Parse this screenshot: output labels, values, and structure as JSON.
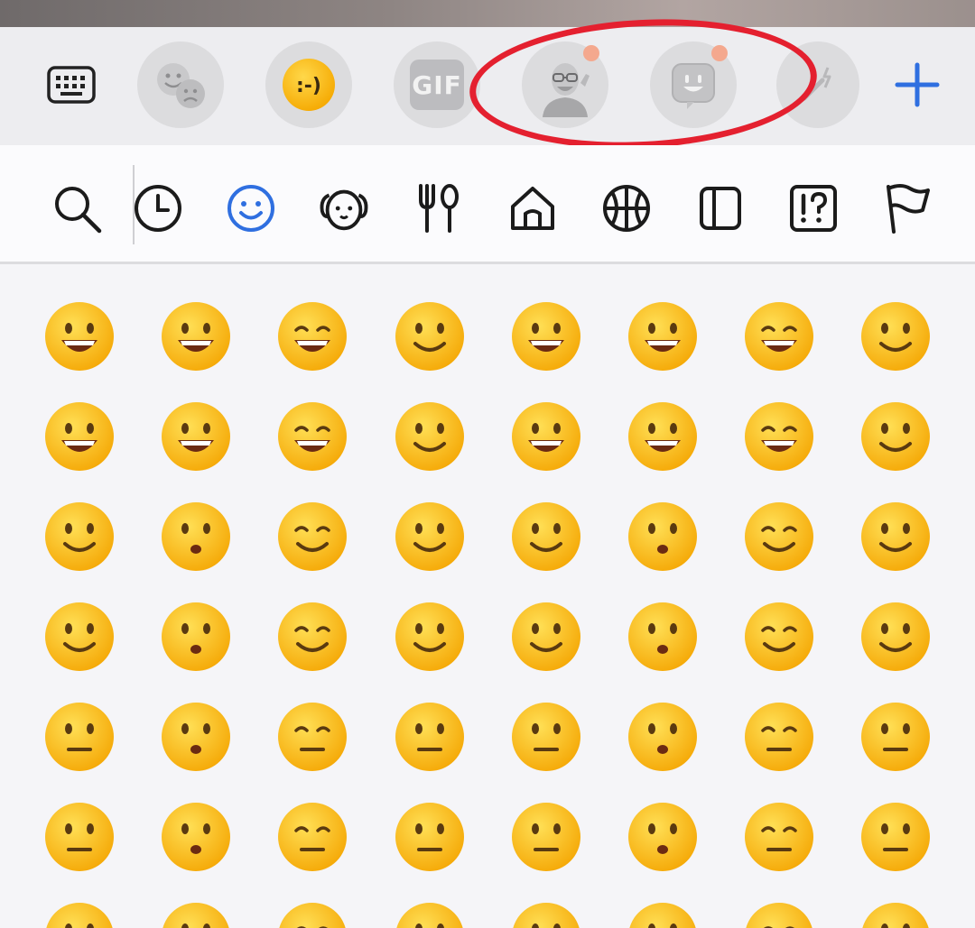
{
  "toolbar": {
    "tools": [
      {
        "name": "keyboard-icon"
      },
      {
        "name": "emoticon-faces-icon"
      },
      {
        "name": "text-emoticon-icon",
        "label": ":-)"
      },
      {
        "name": "gif-icon",
        "label": "GIF"
      },
      {
        "name": "avatar-sticker-icon",
        "new_badge": true
      },
      {
        "name": "sticker-icon",
        "new_badge": true
      },
      {
        "name": "magic-icon"
      },
      {
        "name": "add-icon"
      }
    ],
    "colors": {
      "add": "#2f6fe0",
      "badge": "#f4a88e",
      "annotation": "#e4202f"
    }
  },
  "categories": {
    "items": [
      "search-icon",
      "recent-icon",
      "smileys-icon",
      "animals-icon",
      "food-icon",
      "places-icon",
      "activity-icon",
      "objects-icon",
      "symbols-icon",
      "flags-icon"
    ],
    "selected": "smileys-icon",
    "selected_color": "#2f6fe0"
  },
  "emoji_grid": {
    "rows": [
      [
        "😀",
        "😃",
        "😄",
        "😁",
        "😆",
        "😅",
        "🤣",
        "😂"
      ],
      [
        "🙂",
        "🙃",
        "🫠",
        "😉",
        "😊",
        "😇",
        "🥰",
        "😍"
      ],
      [
        "🤩",
        "😘",
        "😗",
        "☺️",
        "😚",
        "😙",
        "🥲",
        "😋"
      ],
      [
        "😛",
        "😜",
        "🤪",
        "😝",
        "🤑",
        "🤗",
        "🤭",
        "🫢"
      ],
      [
        "🫣",
        "🤫",
        "🤔",
        "🫡",
        "🤐",
        "🤨",
        "😐",
        "😑"
      ],
      [
        "😶",
        "🫥",
        "😶‍🌫️",
        "😏",
        "😒",
        "🙄",
        "😬",
        "😮‍💨"
      ],
      [
        "🤥",
        "😌",
        "😔",
        "😪",
        "🤤",
        "😴",
        "😷",
        "🤒"
      ]
    ]
  }
}
